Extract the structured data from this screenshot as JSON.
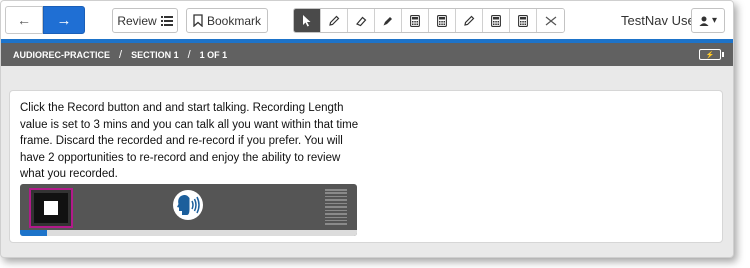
{
  "nav": {
    "back_icon": "arrow-left-icon",
    "next_icon": "arrow-right-icon",
    "review_label": "Review",
    "bookmark_label": "Bookmark"
  },
  "tools": [
    {
      "icon": "pointer-icon",
      "active": true
    },
    {
      "icon": "pencil-icon"
    },
    {
      "icon": "eraser-icon"
    },
    {
      "icon": "highlighter-icon"
    },
    {
      "icon": "calculator-icon"
    },
    {
      "icon": "calculator-icon"
    },
    {
      "icon": "pencil-icon"
    },
    {
      "icon": "calculator-icon"
    },
    {
      "icon": "calculator-icon"
    },
    {
      "icon": "cross-out-icon"
    }
  ],
  "user": {
    "name": "TestNav User"
  },
  "breadcrumb": {
    "items": [
      "AUDIOREC-PRACTICE",
      "SECTION 1",
      "1 OF 1"
    ],
    "separator": "/"
  },
  "question": {
    "prompt": "Click the Record button and and start talking. Recording Length value is set to 3 mins and you can talk all you want within that time frame. Discard the recorded and re-record if you prefer. You will have 2 opportunities to re-record and enjoy the ability to review what you recorded."
  },
  "recorder": {
    "state": "recording",
    "progress": 0.08
  },
  "colors": {
    "accent": "#1d73c9",
    "next_button": "#1f6fd4",
    "header_bar": "#616161",
    "stop_outline": "#b21a8a"
  }
}
